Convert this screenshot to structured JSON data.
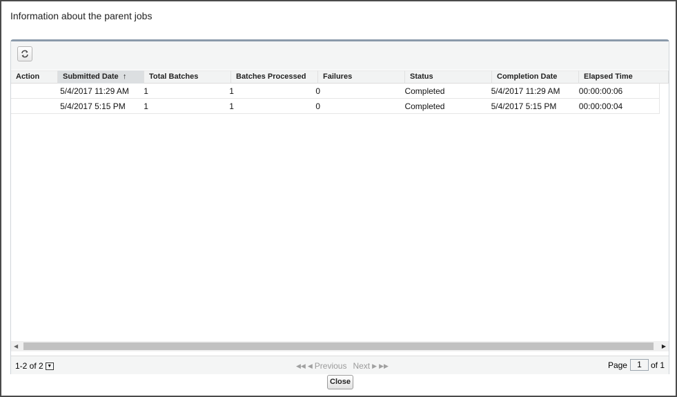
{
  "dialog": {
    "title": "Information about the parent jobs"
  },
  "toolbar": {
    "refresh_icon": "refresh-icon"
  },
  "table": {
    "columns": [
      "Action",
      "Submitted Date",
      "Total Batches",
      "Batches Processed",
      "Failures",
      "Status",
      "Completion Date",
      "Elapsed Time"
    ],
    "sort_indicator": "↑",
    "sorted_column": "Submitted Date",
    "rows": [
      [
        "",
        "5/4/2017 11:29 AM",
        "1",
        "1",
        "0",
        "Completed",
        "5/4/2017 11:29 AM",
        "00:00:00:06"
      ],
      [
        "",
        "5/4/2017 5:15 PM",
        "1",
        "1",
        "0",
        "Completed",
        "5/4/2017 5:15 PM",
        "00:00:00:04"
      ]
    ]
  },
  "pager": {
    "range": "1-2 of 2",
    "previous": "Previous",
    "next": "Next",
    "page_label": "Page",
    "page_value": "1",
    "of_label": "of 1"
  },
  "footer": {
    "close_label": "Close"
  }
}
